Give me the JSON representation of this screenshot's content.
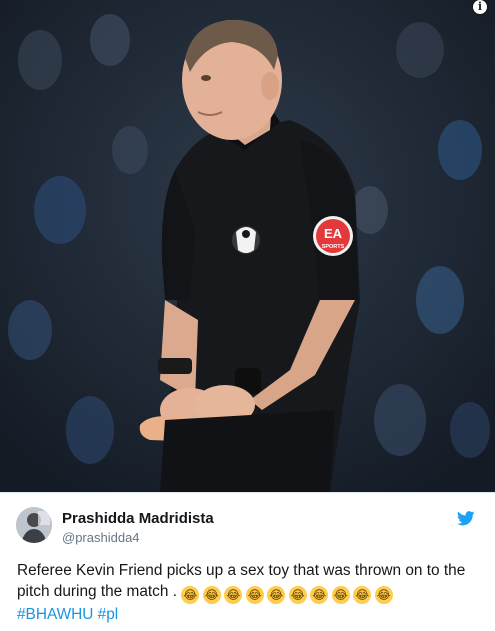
{
  "photo": {
    "info_icon_glyph": "i",
    "badge_text_ea": "EA",
    "badge_text_sports": "SPORTS"
  },
  "tweet": {
    "author_name": "Prashidda Madridista",
    "author_handle": "@prashidda4",
    "body_text": "Referee Kevin Friend picks up a sex toy that was thrown on to the pitch during the match .",
    "emoji_glyph": "😂",
    "emoji_count": 10,
    "hashtags": [
      "#BHAWHU",
      "#pl"
    ],
    "icons": [
      "twitter-bird-icon",
      "info-icon"
    ],
    "colors": {
      "link": "#1b95e0",
      "twitter_blue": "#1da1f2",
      "text": "#14171a",
      "muted": "#657786"
    }
  }
}
